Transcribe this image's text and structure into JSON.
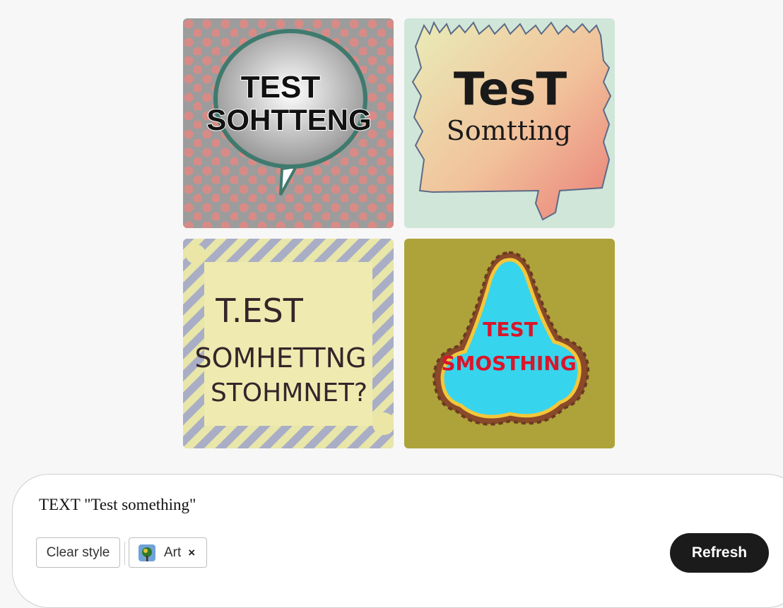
{
  "gallery": {
    "images": [
      {
        "line1": "TEST",
        "line2": "SOHTTENG"
      },
      {
        "line1": "TesT",
        "line2": "Somtting"
      },
      {
        "line1": "T.EST",
        "line2": "SOMHETTNG",
        "line3": "STOHMNET?"
      },
      {
        "line1": "TEST",
        "line2": "SMOSTHING"
      }
    ]
  },
  "prompt": {
    "text": "TEXT \"Test something\"",
    "clear_style_label": "Clear style",
    "style_chip_label": "Art",
    "style_chip_close": "×",
    "refresh_label": "Refresh"
  },
  "colors": {
    "page_bg": "#f7f7f7",
    "refresh_bg": "#1b1b1b",
    "tile1_bg": "#9c9c9c",
    "tile2_bg": "#cfe6d9",
    "tile3_bg": "#aab0c6",
    "tile4_bg": "#aea33a"
  }
}
